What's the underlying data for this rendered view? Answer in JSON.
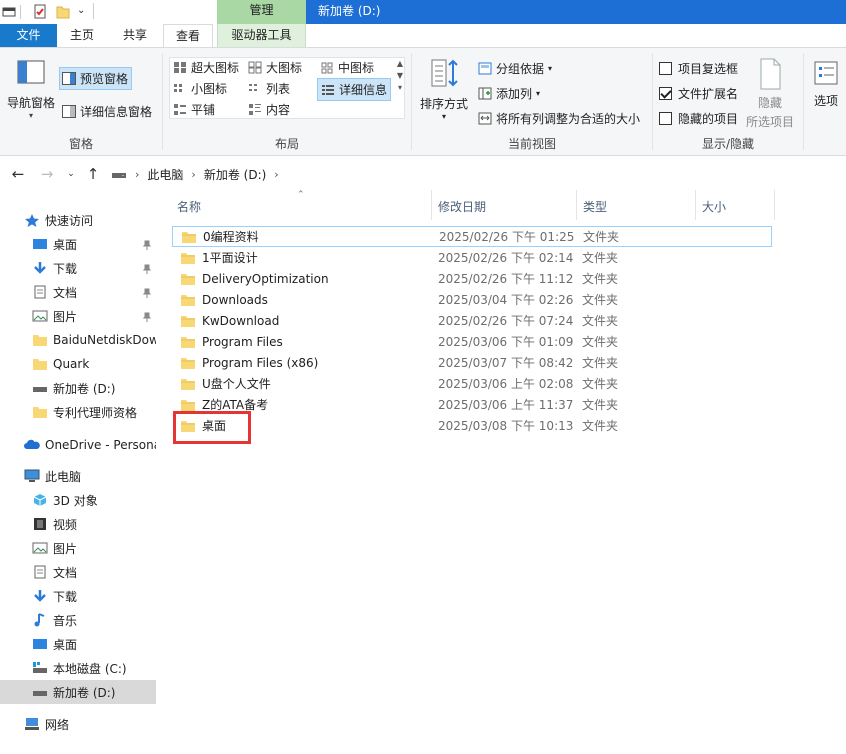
{
  "title": {
    "context_tab": "管理",
    "window_title": "新加卷 (D:)"
  },
  "tabs": {
    "file": "文件",
    "home": "主页",
    "share": "共享",
    "view": "查看",
    "drive_tools": "驱动器工具"
  },
  "ribbon": {
    "panes": {
      "nav_pane": "导航窗格",
      "preview": "预览窗格",
      "details": "详细信息窗格",
      "label": "窗格"
    },
    "layout": {
      "extra_large": "超大图标",
      "large": "大图标",
      "medium": "中图标",
      "small": "小图标",
      "list": "列表",
      "details": "详细信息",
      "tiles": "平铺",
      "content": "内容",
      "label": "布局"
    },
    "current_view": {
      "sort": "排序方式",
      "group": "分组依据",
      "add_column": "添加列",
      "fit_columns": "将所有列调整为合适的大小",
      "label": "当前视图"
    },
    "show_hide": {
      "item_checkboxes": "项目复选框",
      "item_checkboxes_checked": false,
      "file_extensions": "文件扩展名",
      "file_extensions_checked": true,
      "hidden_items": "隐藏的项目",
      "hidden_items_checked": false,
      "hide": "隐藏",
      "selected_items": "所选项目",
      "label": "显示/隐藏"
    },
    "options": "选项"
  },
  "address": {
    "crumbs": [
      "此电脑",
      "新加卷 (D:)"
    ]
  },
  "navpane": {
    "quick_access": "快速访问",
    "qa_items": [
      "桌面",
      "下载",
      "文档",
      "图片",
      "BaiduNetdiskDow",
      "Quark",
      "新加卷 (D:)",
      "专利代理师资格"
    ],
    "onedrive": "OneDrive - Persona",
    "this_pc": "此电脑",
    "pc_items": [
      "3D 对象",
      "视频",
      "图片",
      "文档",
      "下载",
      "音乐",
      "桌面",
      "本地磁盘 (C:)",
      "新加卷 (D:)"
    ],
    "network": "网络"
  },
  "columns": {
    "name": "名称",
    "date": "修改日期",
    "type": "类型",
    "size": "大小"
  },
  "files": [
    {
      "name": "0编程资料",
      "date": "2025/02/26 下午 01:25",
      "type": "文件夹"
    },
    {
      "name": "1平面设计",
      "date": "2025/02/26 下午 02:14",
      "type": "文件夹"
    },
    {
      "name": "DeliveryOptimization",
      "date": "2025/02/26 下午 11:12",
      "type": "文件夹"
    },
    {
      "name": "Downloads",
      "date": "2025/03/04 下午 02:26",
      "type": "文件夹"
    },
    {
      "name": "KwDownload",
      "date": "2025/02/26 下午 07:24",
      "type": "文件夹"
    },
    {
      "name": "Program Files",
      "date": "2025/03/06 下午 01:09",
      "type": "文件夹"
    },
    {
      "name": "Program Files (x86)",
      "date": "2025/03/07 下午 08:42",
      "type": "文件夹"
    },
    {
      "name": "U盘个人文件",
      "date": "2025/03/06 上午 02:08",
      "type": "文件夹"
    },
    {
      "name": "Z的ATA备考",
      "date": "2025/03/06 上午 11:37",
      "type": "文件夹"
    },
    {
      "name": "桌面",
      "date": "2025/03/08 下午 10:13",
      "type": "文件夹"
    }
  ],
  "colors": {
    "accent": "#1979ca",
    "title_strip": "#1d6fd6",
    "context_tab": "#a9d8a4",
    "folder": "#f8d775",
    "highlight_box": "#e53434"
  }
}
